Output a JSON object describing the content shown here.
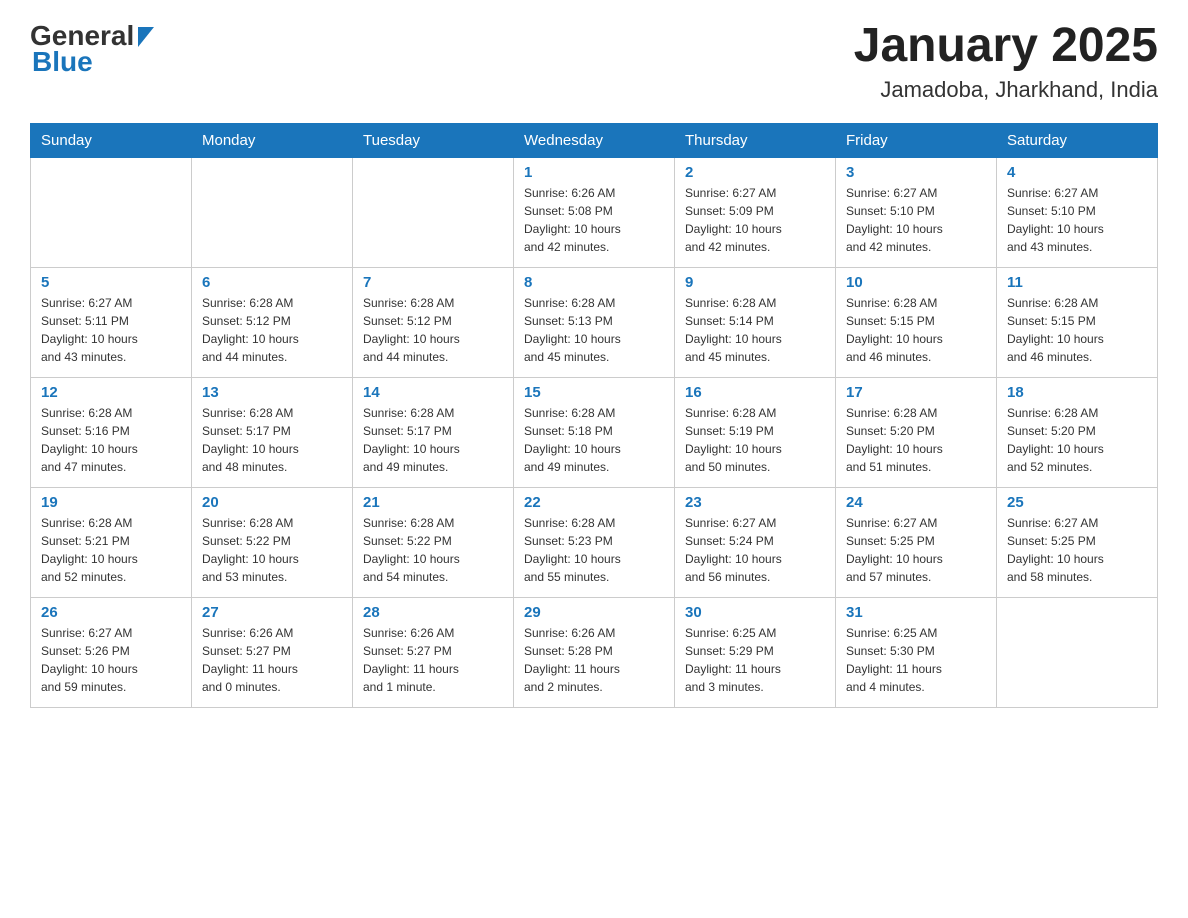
{
  "header": {
    "logo": {
      "general": "General",
      "blue": "Blue"
    },
    "title": "January 2025",
    "location": "Jamadoba, Jharkhand, India"
  },
  "weekdays": [
    "Sunday",
    "Monday",
    "Tuesday",
    "Wednesday",
    "Thursday",
    "Friday",
    "Saturday"
  ],
  "weeks": [
    [
      {
        "day": "",
        "info": ""
      },
      {
        "day": "",
        "info": ""
      },
      {
        "day": "",
        "info": ""
      },
      {
        "day": "1",
        "info": "Sunrise: 6:26 AM\nSunset: 5:08 PM\nDaylight: 10 hours\nand 42 minutes."
      },
      {
        "day": "2",
        "info": "Sunrise: 6:27 AM\nSunset: 5:09 PM\nDaylight: 10 hours\nand 42 minutes."
      },
      {
        "day": "3",
        "info": "Sunrise: 6:27 AM\nSunset: 5:10 PM\nDaylight: 10 hours\nand 42 minutes."
      },
      {
        "day": "4",
        "info": "Sunrise: 6:27 AM\nSunset: 5:10 PM\nDaylight: 10 hours\nand 43 minutes."
      }
    ],
    [
      {
        "day": "5",
        "info": "Sunrise: 6:27 AM\nSunset: 5:11 PM\nDaylight: 10 hours\nand 43 minutes."
      },
      {
        "day": "6",
        "info": "Sunrise: 6:28 AM\nSunset: 5:12 PM\nDaylight: 10 hours\nand 44 minutes."
      },
      {
        "day": "7",
        "info": "Sunrise: 6:28 AM\nSunset: 5:12 PM\nDaylight: 10 hours\nand 44 minutes."
      },
      {
        "day": "8",
        "info": "Sunrise: 6:28 AM\nSunset: 5:13 PM\nDaylight: 10 hours\nand 45 minutes."
      },
      {
        "day": "9",
        "info": "Sunrise: 6:28 AM\nSunset: 5:14 PM\nDaylight: 10 hours\nand 45 minutes."
      },
      {
        "day": "10",
        "info": "Sunrise: 6:28 AM\nSunset: 5:15 PM\nDaylight: 10 hours\nand 46 minutes."
      },
      {
        "day": "11",
        "info": "Sunrise: 6:28 AM\nSunset: 5:15 PM\nDaylight: 10 hours\nand 46 minutes."
      }
    ],
    [
      {
        "day": "12",
        "info": "Sunrise: 6:28 AM\nSunset: 5:16 PM\nDaylight: 10 hours\nand 47 minutes."
      },
      {
        "day": "13",
        "info": "Sunrise: 6:28 AM\nSunset: 5:17 PM\nDaylight: 10 hours\nand 48 minutes."
      },
      {
        "day": "14",
        "info": "Sunrise: 6:28 AM\nSunset: 5:17 PM\nDaylight: 10 hours\nand 49 minutes."
      },
      {
        "day": "15",
        "info": "Sunrise: 6:28 AM\nSunset: 5:18 PM\nDaylight: 10 hours\nand 49 minutes."
      },
      {
        "day": "16",
        "info": "Sunrise: 6:28 AM\nSunset: 5:19 PM\nDaylight: 10 hours\nand 50 minutes."
      },
      {
        "day": "17",
        "info": "Sunrise: 6:28 AM\nSunset: 5:20 PM\nDaylight: 10 hours\nand 51 minutes."
      },
      {
        "day": "18",
        "info": "Sunrise: 6:28 AM\nSunset: 5:20 PM\nDaylight: 10 hours\nand 52 minutes."
      }
    ],
    [
      {
        "day": "19",
        "info": "Sunrise: 6:28 AM\nSunset: 5:21 PM\nDaylight: 10 hours\nand 52 minutes."
      },
      {
        "day": "20",
        "info": "Sunrise: 6:28 AM\nSunset: 5:22 PM\nDaylight: 10 hours\nand 53 minutes."
      },
      {
        "day": "21",
        "info": "Sunrise: 6:28 AM\nSunset: 5:22 PM\nDaylight: 10 hours\nand 54 minutes."
      },
      {
        "day": "22",
        "info": "Sunrise: 6:28 AM\nSunset: 5:23 PM\nDaylight: 10 hours\nand 55 minutes."
      },
      {
        "day": "23",
        "info": "Sunrise: 6:27 AM\nSunset: 5:24 PM\nDaylight: 10 hours\nand 56 minutes."
      },
      {
        "day": "24",
        "info": "Sunrise: 6:27 AM\nSunset: 5:25 PM\nDaylight: 10 hours\nand 57 minutes."
      },
      {
        "day": "25",
        "info": "Sunrise: 6:27 AM\nSunset: 5:25 PM\nDaylight: 10 hours\nand 58 minutes."
      }
    ],
    [
      {
        "day": "26",
        "info": "Sunrise: 6:27 AM\nSunset: 5:26 PM\nDaylight: 10 hours\nand 59 minutes."
      },
      {
        "day": "27",
        "info": "Sunrise: 6:26 AM\nSunset: 5:27 PM\nDaylight: 11 hours\nand 0 minutes."
      },
      {
        "day": "28",
        "info": "Sunrise: 6:26 AM\nSunset: 5:27 PM\nDaylight: 11 hours\nand 1 minute."
      },
      {
        "day": "29",
        "info": "Sunrise: 6:26 AM\nSunset: 5:28 PM\nDaylight: 11 hours\nand 2 minutes."
      },
      {
        "day": "30",
        "info": "Sunrise: 6:25 AM\nSunset: 5:29 PM\nDaylight: 11 hours\nand 3 minutes."
      },
      {
        "day": "31",
        "info": "Sunrise: 6:25 AM\nSunset: 5:30 PM\nDaylight: 11 hours\nand 4 minutes."
      },
      {
        "day": "",
        "info": ""
      }
    ]
  ]
}
